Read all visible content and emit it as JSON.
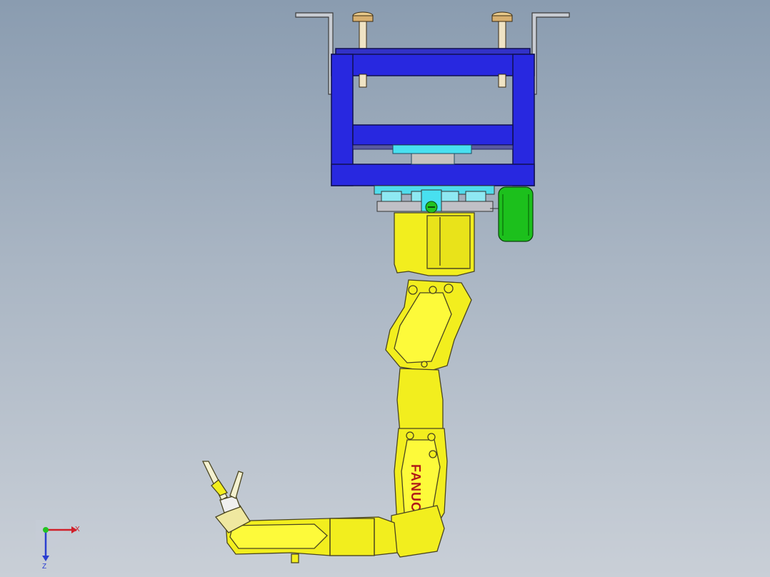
{
  "app": {
    "type": "CAD 3D viewport"
  },
  "model": {
    "brand_label": "FANUC",
    "components": [
      "ceiling-bracket",
      "mounting-bolt",
      "blue-frame",
      "cyan-mount",
      "robot-base",
      "green-motor",
      "robot-arm",
      "gripper"
    ]
  },
  "triad": {
    "x_label": "X",
    "z_label": "Z"
  },
  "colors": {
    "background_top": "#8a9cb0",
    "background_bottom": "#c9cfd7",
    "frame": "#2828e0",
    "robot": "#f2ee1e",
    "motor": "#18c018",
    "mount": "#48e0f0",
    "bracket": "#b8bcc4",
    "bolt": "#e6c98a"
  }
}
